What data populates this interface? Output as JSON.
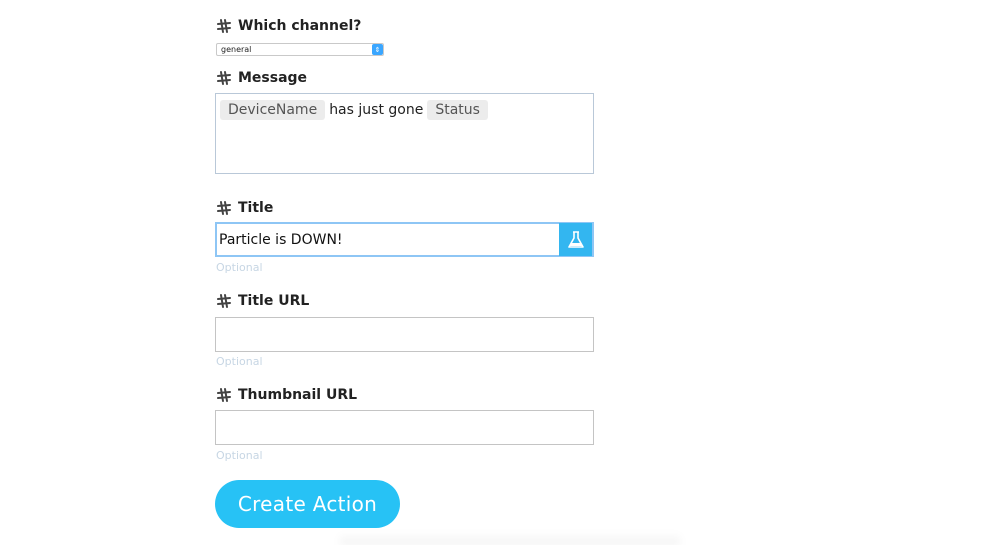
{
  "channel": {
    "label": "Which channel?",
    "selected": "general"
  },
  "message": {
    "label": "Message",
    "ingredient_1": "DeviceName",
    "text": "has just gone",
    "ingredient_2": "Status"
  },
  "title": {
    "label": "Title",
    "value": "Particle is DOWN!",
    "hint": "Optional"
  },
  "title_url": {
    "label": "Title URL",
    "value": "",
    "hint": "Optional"
  },
  "thumbnail_url": {
    "label": "Thumbnail URL",
    "value": "",
    "hint": "Optional"
  },
  "create_button": {
    "label": "Create Action"
  },
  "icons": {
    "field": "slack-icon",
    "ingredient": "flask-icon",
    "select_arrows": "updown-icon"
  },
  "colors": {
    "accent": "#27c2f5",
    "hint": "#c7d6e4"
  }
}
